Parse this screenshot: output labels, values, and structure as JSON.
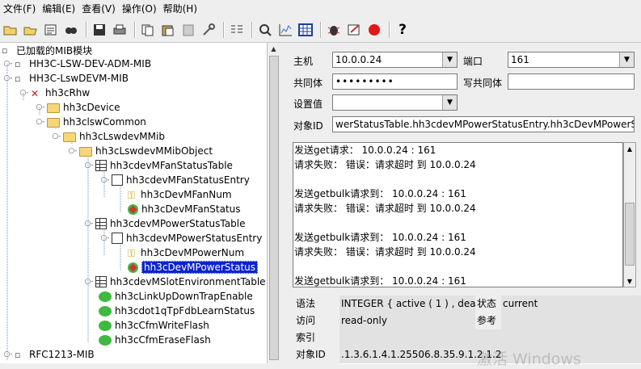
{
  "menu": [
    "文件(F)",
    "编辑(E)",
    "查看(V)",
    "操作(O)",
    "帮助(H)"
  ],
  "toolbar_icons": [
    "open-folder-icon",
    "open-file-icon",
    "load-mib-icon",
    "find-icon",
    "save-icon",
    "print-icon",
    "copy-icon",
    "paste-icon",
    "clipboard-icon",
    "tools-icon",
    "multi-get-icon",
    "graph-icon",
    "bar-chart-icon",
    "table-icon",
    "debug-icon",
    "trap-icon",
    "stop-icon",
    "help-icon"
  ],
  "tree": {
    "root": "已加载的MIB模块",
    "nodes": [
      {
        "label": "HH3C-LSW-DEV-ADM-MIB"
      },
      {
        "label": "HH3C-LswDEVM-MIB"
      },
      {
        "label": "hh3cRhw"
      },
      {
        "label": "hh3cDevice"
      },
      {
        "label": "hh3clswCommon"
      },
      {
        "label": "hh3cLswdevMMib"
      },
      {
        "label": "hh3cLswdevMMibObject"
      },
      {
        "label": "hh3cdevMFanStatusTable"
      },
      {
        "label": "hh3cdevMFanStatusEntry"
      },
      {
        "label": "hh3cDevMFanNum"
      },
      {
        "label": "hh3cDevMFanStatus"
      },
      {
        "label": "hh3cdevMPowerStatusTable"
      },
      {
        "label": "hh3cdevMPowerStatusEntry"
      },
      {
        "label": "hh3cDevMPowerNum"
      },
      {
        "label": "hh3cDevMPowerStatus"
      },
      {
        "label": "hh3cdevMSlotEnvironmentTable"
      },
      {
        "label": "hh3cLinkUpDownTrapEnable"
      },
      {
        "label": "hh3cdot1qTpFdbLearnStatus"
      },
      {
        "label": "hh3cCfmWriteFlash"
      },
      {
        "label": "hh3cCfmEraseFlash"
      },
      {
        "label": "RFC1213-MIB"
      }
    ]
  },
  "form": {
    "host_label": "主机",
    "host_value": "10.0.0.24",
    "port_label": "端口",
    "port_value": "161",
    "community_label": "共同体",
    "community_value": "•••••••••",
    "write_community_label": "写共同体",
    "write_community_value": "",
    "set_value_label": "设置值",
    "set_value_value": "",
    "oid_label": "对象ID",
    "oid_value": "werStatusTable.hh3cdevMPowerStatusEntry.hh3cDevMPowerStatus"
  },
  "log": [
    "发送get请求：  10.0.0.24 : 161",
    "请求失败：  错误：请求超时 到 10.0.0.24",
    "",
    "发送getbulk请求到：  10.0.0.24 : 161",
    "请求失败：  错误：请求超时 到 10.0.0.24",
    "",
    "发送getbulk请求到：  10.0.0.24 : 161",
    "请求失败：  错误：请求超时 到 10.0.0.24",
    "",
    "发送getbulk请求到：  10.0.0.24 : 161"
  ],
  "info": {
    "syntax_label": "语法",
    "syntax_value": "INTEGER  { active ( 1 ) , deacti",
    "status_label": "状态",
    "status_value": "current",
    "access_label": "访问",
    "access_value": "read-only",
    "reference_label": "参考",
    "reference_value": "",
    "index_label": "索引",
    "index_value": "",
    "oid_label": "对象ID",
    "oid_value": ".1.3.6.1.4.1.25506.8.35.9.1.2.1.2"
  },
  "watermark": "激活 Windows"
}
